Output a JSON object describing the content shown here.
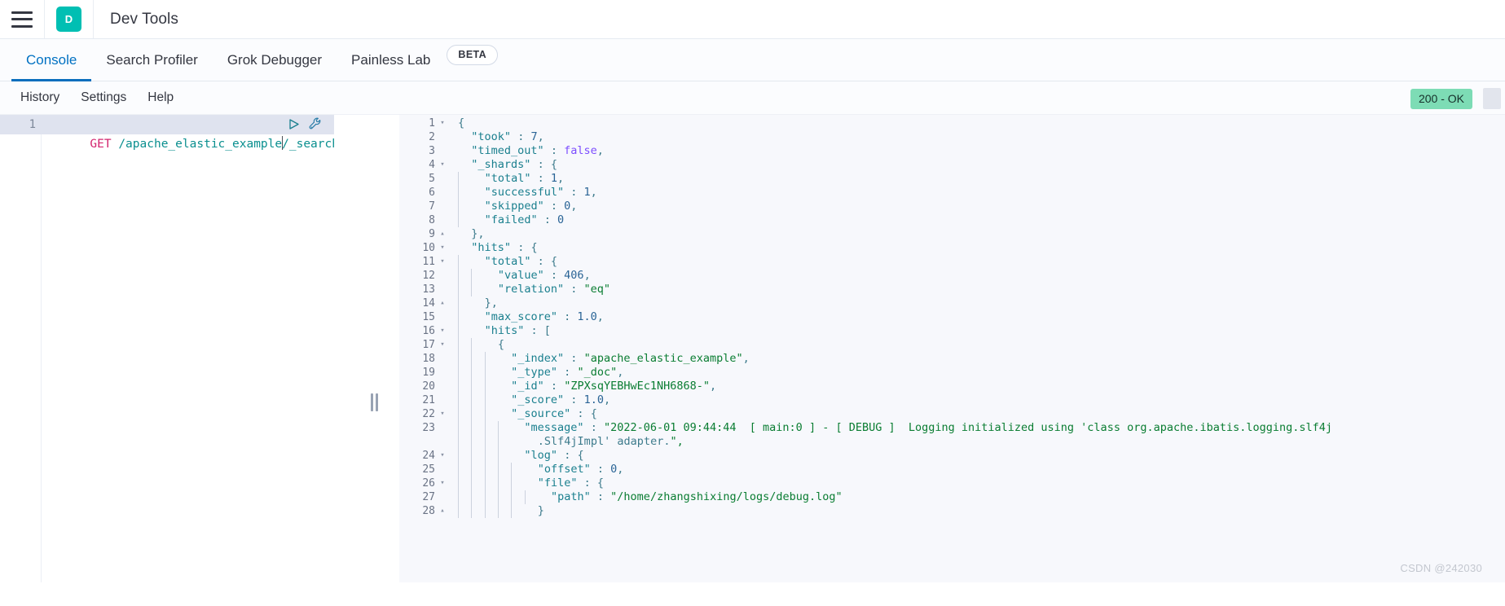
{
  "header": {
    "menu_icon": "hamburger-icon",
    "logo_letter": "D",
    "logo_color": "#00bfb3",
    "title": "Dev Tools"
  },
  "tabs": [
    {
      "label": "Console",
      "active": true
    },
    {
      "label": "Search Profiler",
      "active": false
    },
    {
      "label": "Grok Debugger",
      "active": false
    },
    {
      "label": "Painless Lab",
      "active": false
    }
  ],
  "beta_badge": "BETA",
  "console_menu": {
    "items": [
      "History",
      "Settings",
      "Help"
    ],
    "status": "200 - OK",
    "status_color": "#7ddcb5"
  },
  "request": {
    "line_number": "1",
    "method": "GET",
    "path_before_caret": "/apache_elastic_example",
    "path_after_caret": "/_search",
    "play_icon": "play-icon",
    "wrench_icon": "wrench-icon"
  },
  "response": {
    "lines": [
      {
        "num": "1",
        "fold": "▾",
        "indent": 0,
        "text": "{"
      },
      {
        "num": "2",
        "fold": "",
        "indent": 0,
        "text": "  \"took\" : 7,"
      },
      {
        "num": "3",
        "fold": "",
        "indent": 0,
        "text": "  \"timed_out\" : false,"
      },
      {
        "num": "4",
        "fold": "▾",
        "indent": 0,
        "text": "  \"_shards\" : {"
      },
      {
        "num": "5",
        "fold": "",
        "indent": 1,
        "text": "    \"total\" : 1,"
      },
      {
        "num": "6",
        "fold": "",
        "indent": 1,
        "text": "    \"successful\" : 1,"
      },
      {
        "num": "7",
        "fold": "",
        "indent": 1,
        "text": "    \"skipped\" : 0,"
      },
      {
        "num": "8",
        "fold": "",
        "indent": 1,
        "text": "    \"failed\" : 0"
      },
      {
        "num": "9",
        "fold": "▴",
        "indent": 0,
        "text": "  },"
      },
      {
        "num": "10",
        "fold": "▾",
        "indent": 0,
        "text": "  \"hits\" : {"
      },
      {
        "num": "11",
        "fold": "▾",
        "indent": 1,
        "text": "    \"total\" : {"
      },
      {
        "num": "12",
        "fold": "",
        "indent": 2,
        "text": "      \"value\" : 406,"
      },
      {
        "num": "13",
        "fold": "",
        "indent": 2,
        "text": "      \"relation\" : \"eq\""
      },
      {
        "num": "14",
        "fold": "▴",
        "indent": 1,
        "text": "    },"
      },
      {
        "num": "15",
        "fold": "",
        "indent": 1,
        "text": "    \"max_score\" : 1.0,"
      },
      {
        "num": "16",
        "fold": "▾",
        "indent": 1,
        "text": "    \"hits\" : ["
      },
      {
        "num": "17",
        "fold": "▾",
        "indent": 2,
        "text": "      {"
      },
      {
        "num": "18",
        "fold": "",
        "indent": 3,
        "text": "        \"_index\" : \"apache_elastic_example\","
      },
      {
        "num": "19",
        "fold": "",
        "indent": 3,
        "text": "        \"_type\" : \"_doc\","
      },
      {
        "num": "20",
        "fold": "",
        "indent": 3,
        "text": "        \"_id\" : \"ZPXsqYEBHwEc1NH6868-\","
      },
      {
        "num": "21",
        "fold": "",
        "indent": 3,
        "text": "        \"_score\" : 1.0,"
      },
      {
        "num": "22",
        "fold": "▾",
        "indent": 3,
        "text": "        \"_source\" : {"
      },
      {
        "num": "23",
        "fold": "",
        "indent": 4,
        "text": "          \"message\" : \"2022-06-01 09:44:44  [ main:0 ] - [ DEBUG ]  Logging initialized using 'class org.apache.ibatis.logging.slf4j"
      },
      {
        "num": "",
        "fold": "",
        "indent": 4,
        "text": "            .Slf4jImpl' adapter.\","
      },
      {
        "num": "24",
        "fold": "▾",
        "indent": 4,
        "text": "          \"log\" : {"
      },
      {
        "num": "25",
        "fold": "",
        "indent": 5,
        "text": "            \"offset\" : 0,"
      },
      {
        "num": "26",
        "fold": "▾",
        "indent": 5,
        "text": "            \"file\" : {"
      },
      {
        "num": "27",
        "fold": "",
        "indent": 6,
        "text": "              \"path\" : \"/home/zhangshixing/logs/debug.log\""
      },
      {
        "num": "28",
        "fold": "▴",
        "indent": 5,
        "text": "            }"
      }
    ]
  },
  "watermark": "CSDN @242030"
}
